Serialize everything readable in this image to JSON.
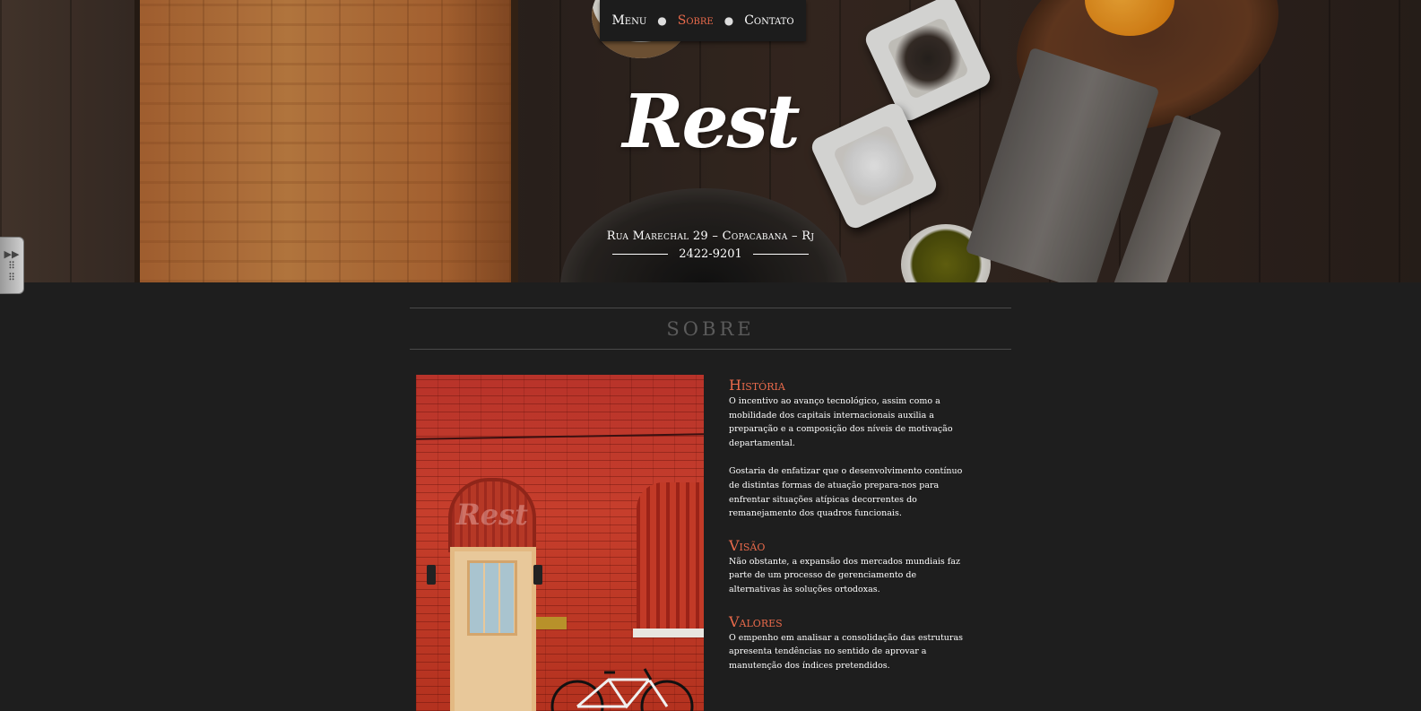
{
  "nav": {
    "items": [
      {
        "label": "Menu",
        "active": false
      },
      {
        "label": "Sobre",
        "active": true
      },
      {
        "label": "Contato",
        "active": false
      }
    ],
    "active_color": "#e96a4b"
  },
  "hero": {
    "logo": "Rest",
    "address": "Rua Marechal 29 – Copacabana – Rj",
    "phone": "2422-9201"
  },
  "side_widget": {
    "icons": [
      "fast-forward-icon",
      "grid-dots-icon"
    ]
  },
  "sobre": {
    "heading": "SOBRE",
    "photo_watermark": "Rest",
    "historia": {
      "title": "História",
      "p1": "O incentivo ao avanço tecnológico, assim como a mobilidade dos capitais internacionais auxilia a preparação e a composição dos níveis de motivação departamental.",
      "p2": "Gostaria de enfatizar que o desenvolvimento contínuo de distintas formas de atuação prepara-nos para enfrentar situações atípicas decorrentes do remanejamento dos quadros funcionais."
    },
    "visao": {
      "title": "Visão",
      "p1": "Não obstante, a expansão dos mercados mundiais faz parte de um processo de gerenciamento de alternativas às soluções ortodoxas."
    },
    "valores": {
      "title": "Valores",
      "p1": "O empenho em analisar a consolidação das estruturas apresenta tendências no sentido de aprovar a manutenção dos índices pretendidos."
    }
  }
}
